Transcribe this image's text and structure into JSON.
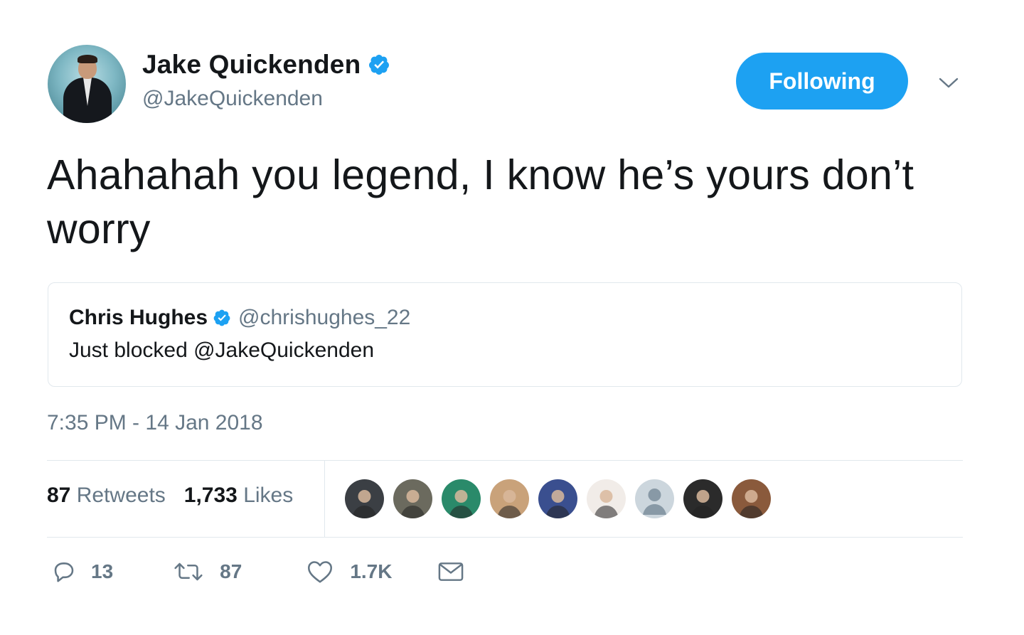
{
  "author": {
    "name": "Jake Quickenden",
    "handle": "@JakeQuickenden",
    "verified": true,
    "avatar": "avatar"
  },
  "follow_button": {
    "label": "Following",
    "color": "#1da1f2"
  },
  "menu_icon": "chevron-down-icon",
  "tweet": {
    "text": "Ahahahah you legend, I know he’s yours don’t worry",
    "timestamp": "7:35 PM - 14 Jan 2018"
  },
  "quoted_tweet": {
    "name": "Chris Hughes",
    "handle": "@chrishughes_22",
    "verified": true,
    "text": "Just blocked @JakeQuickenden"
  },
  "stats": {
    "retweets_count": "87",
    "retweets_label": "Retweets",
    "likes_count": "1,733",
    "likes_label": "Likes"
  },
  "likers": [
    {
      "color": "#3b3f44"
    },
    {
      "color": "#6b6a5e"
    },
    {
      "color": "#2a8a6a"
    },
    {
      "color": "#c9a27a"
    },
    {
      "color": "#3a4f8f"
    },
    {
      "color": "#f1ece8"
    },
    {
      "color": "#ccd6dd"
    },
    {
      "color": "#2b2b2b"
    },
    {
      "color": "#8a5a3c"
    }
  ],
  "actions": {
    "reply_count": "13",
    "retweet_count": "87",
    "like_count": "1.7K"
  },
  "colors": {
    "verified": "#1da1f2",
    "secondary_text": "#657786",
    "divider": "#e1e8ed"
  }
}
